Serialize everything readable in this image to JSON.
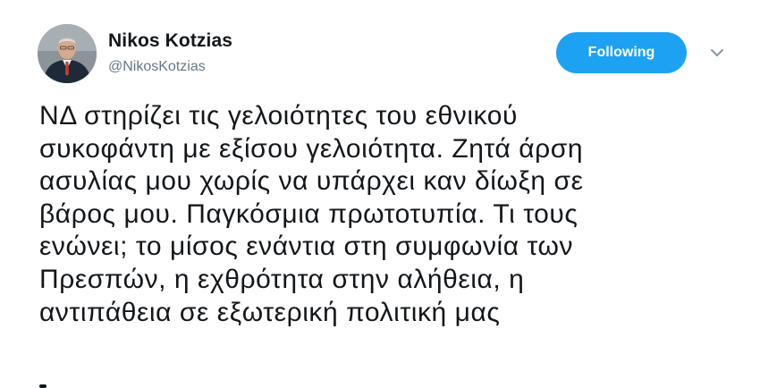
{
  "tweet": {
    "author": {
      "display_name": "Nikos Kotzias",
      "handle": "@NikosKotzias"
    },
    "follow_button_label": "Following",
    "text_lines": [
      "ΝΔ στηρίζει τις γελοιότητες του εθνικού",
      "συκοφάντη με εξίσου γελοιότητα. Ζητά άρση",
      "ασυλίας μου χωρίς να υπάρχει καν δίωξη σε",
      "βάρος μου. Παγκόσμια πρωτοτυπία. Τι τους",
      "ενώνει; το μίσος ενάντια στη συμφωνία των",
      "Πρεσπών, η εχθρότητα στην αλήθεια, η",
      "αντιπάθεια σε εξωτερική πολιτική μας"
    ],
    "icons": {
      "avatar": "profile-photo",
      "menu": "chevron-down-icon"
    },
    "colors": {
      "follow_button": "#1da1f2",
      "text": "#14171a",
      "secondary": "#657786"
    }
  }
}
